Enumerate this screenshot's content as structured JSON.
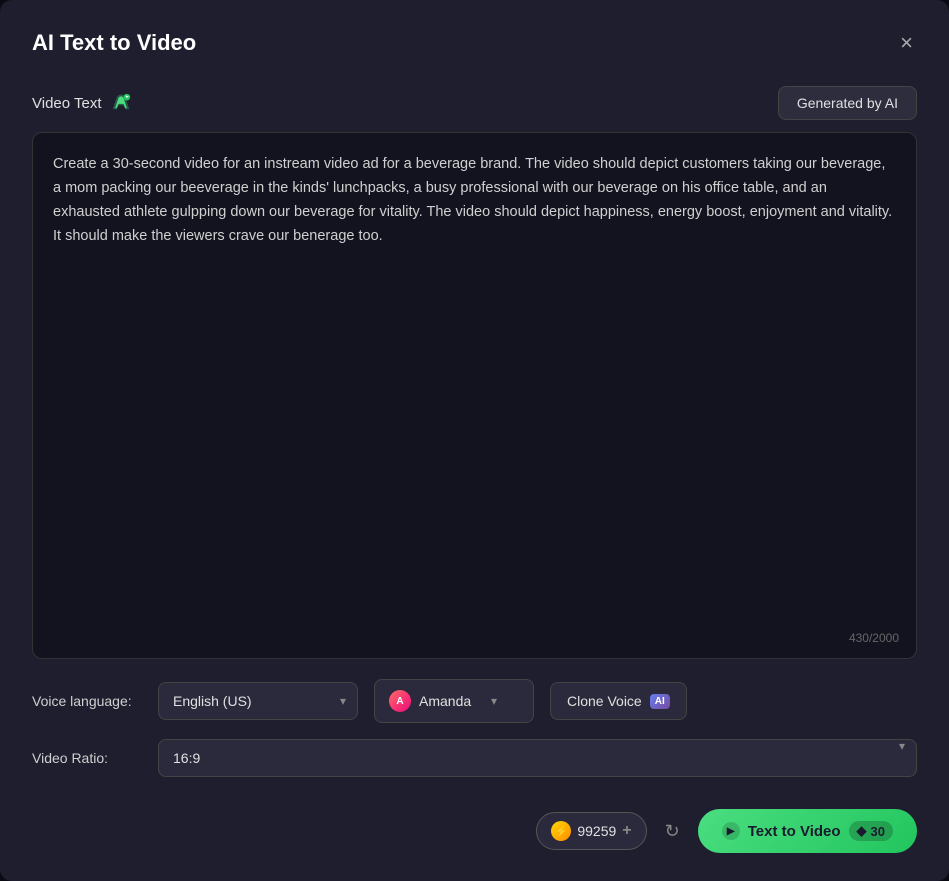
{
  "modal": {
    "title": "AI Text to Video",
    "close_label": "×"
  },
  "video_text_section": {
    "label": "Video Text",
    "generated_by_ai_label": "Generated by AI",
    "content": "Create a 30-second video for an instream video ad for a beverage brand. The video should depict customers taking our beverage, a mom packing our beeverage in the kinds' lunchpacks, a busy professional with our beverage on his office table, and an exhausted athlete gulpping down our beverage for vitality. The video should depict happiness, energy boost, enjoyment and vitality. It should make the viewers crave our benerage too.",
    "char_count": "430/2000"
  },
  "voice_controls": {
    "voice_language_label": "Voice language:",
    "language_value": "English (US)",
    "voice_name": "Amanda",
    "clone_voice_label": "Clone Voice",
    "ai_badge": "AI"
  },
  "video_ratio": {
    "label": "Video Ratio:",
    "value": "16:9"
  },
  "footer": {
    "credits_amount": "99259",
    "credits_add": "+",
    "text_to_video_label": "Text to Video",
    "cost": "30"
  },
  "icons": {
    "ai_edit": "✏",
    "close": "✕",
    "chevron_down": "▾",
    "refresh": "↻",
    "bolt": "⚡",
    "diamond": "◆"
  }
}
